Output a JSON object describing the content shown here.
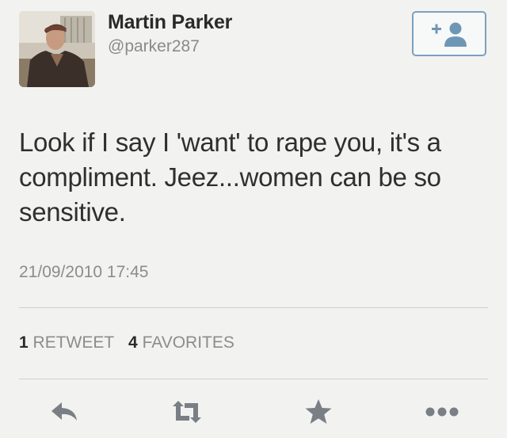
{
  "user": {
    "name": "Martin Parker",
    "handle": "@parker287"
  },
  "tweet": {
    "text": "Look if I say I 'want' to rape you, it's a compliment. Jeez...women can be so sensitive.",
    "timestamp": "21/09/2010 17:45"
  },
  "stats": {
    "retweets_count": "1",
    "retweets_label": "RETWEET",
    "favorites_count": "4",
    "favorites_label": "FAVORITES"
  },
  "icons": {
    "follow": "add-user-icon",
    "reply": "reply-icon",
    "retweet": "retweet-icon",
    "favorite": "star-icon",
    "more": "more-icon"
  },
  "colors": {
    "follow_accent": "#6e97b6",
    "action_icon": "#7a7f86"
  }
}
